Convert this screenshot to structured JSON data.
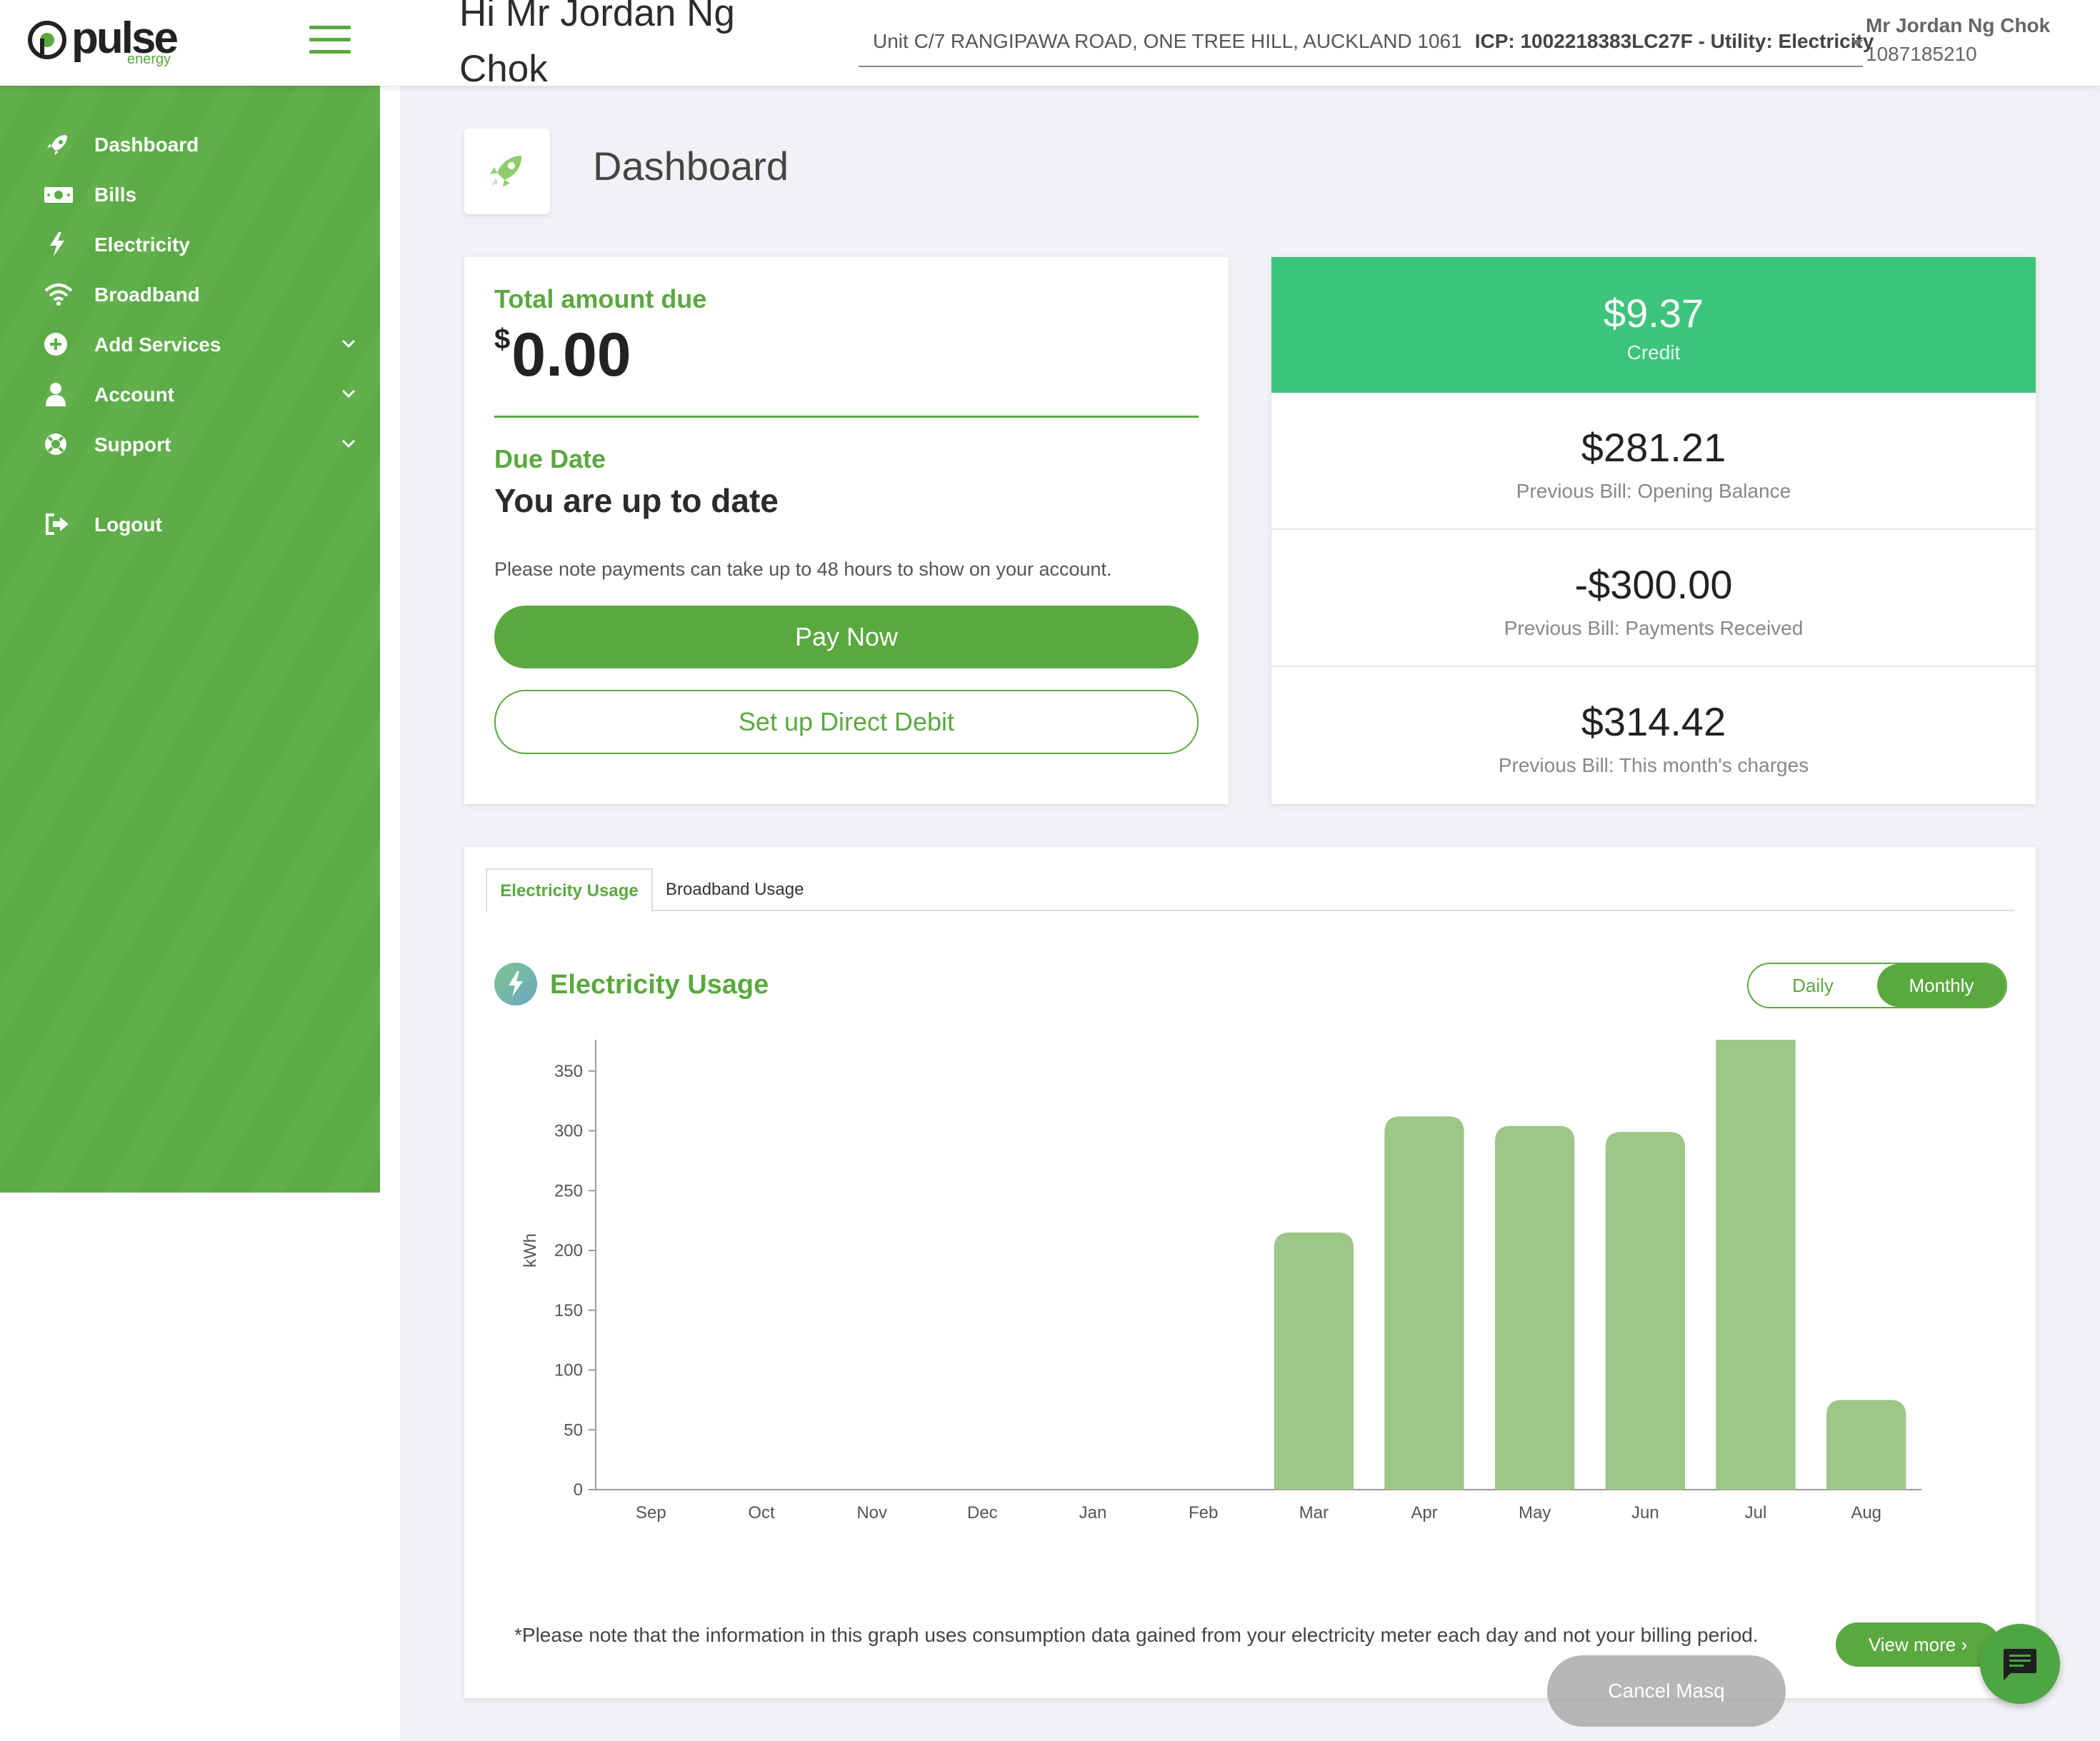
{
  "header": {
    "logo_text": "pulse",
    "logo_sub": "energy",
    "greeting": "Hi Mr Jordan Ng Chok",
    "address": "Unit C/7 RANGIPAWA ROAD, ONE TREE HILL, AUCKLAND 1061",
    "icp": "ICP: 1002218383LC27F - Utility: Electricity",
    "user_name": "Mr Jordan Ng Chok",
    "account_number": "1087185210"
  },
  "sidebar": {
    "items": [
      {
        "label": "Dashboard",
        "icon": "rocket-icon"
      },
      {
        "label": "Bills",
        "icon": "money-icon"
      },
      {
        "label": "Electricity",
        "icon": "bolt-icon"
      },
      {
        "label": "Broadband",
        "icon": "wifi-icon"
      },
      {
        "label": "Add Services",
        "icon": "plus-circle-icon"
      },
      {
        "label": "Account",
        "icon": "user-icon"
      },
      {
        "label": "Support",
        "icon": "lifebuoy-icon"
      },
      {
        "label": "Logout",
        "icon": "logout-icon"
      }
    ]
  },
  "page": {
    "title": "Dashboard"
  },
  "due": {
    "total_label": "Total amount due",
    "currency": "$",
    "amount": "0.00",
    "due_date_label": "Due Date",
    "status": "You are up to date",
    "note": "Please note payments can take up to 48 hours to show on your account.",
    "pay_now": "Pay Now",
    "direct_debit": "Set up Direct Debit"
  },
  "balance": {
    "credit_value": "$9.37",
    "credit_caption": "Credit",
    "rows": [
      {
        "value": "$281.21",
        "caption": "Previous Bill: Opening Balance"
      },
      {
        "value": "-$300.00",
        "caption": "Previous Bill: Payments Received"
      },
      {
        "value": "$314.42",
        "caption": "Previous Bill: This month's charges"
      }
    ]
  },
  "usage": {
    "tabs": [
      "Electricity Usage",
      "Broadband Usage"
    ],
    "title": "Electricity Usage",
    "toggle_daily": "Daily",
    "toggle_monthly": "Monthly",
    "note": "*Please note that the information in this graph uses consumption data gained from your electricity meter each day and not your billing period.",
    "view_more": "View more"
  },
  "cancel_masq": "Cancel Masq",
  "colors": {
    "brand_green": "#5aa93f",
    "credit_green": "#3cc47c",
    "bar_green": "#9dc788"
  },
  "chart_data": {
    "type": "bar",
    "categories": [
      "Sep",
      "Oct",
      "Nov",
      "Dec",
      "Jan",
      "Feb",
      "Mar",
      "Apr",
      "May",
      "Jun",
      "Jul",
      "Aug"
    ],
    "values": [
      0,
      0,
      0,
      0,
      0,
      0,
      215,
      312,
      304,
      299,
      388,
      75
    ],
    "ylabel": "kWh",
    "ylim": [
      0,
      400
    ],
    "yticks": [
      0,
      50,
      100,
      150,
      200,
      250,
      300,
      350,
      400
    ],
    "grid": false,
    "legend": "none"
  }
}
